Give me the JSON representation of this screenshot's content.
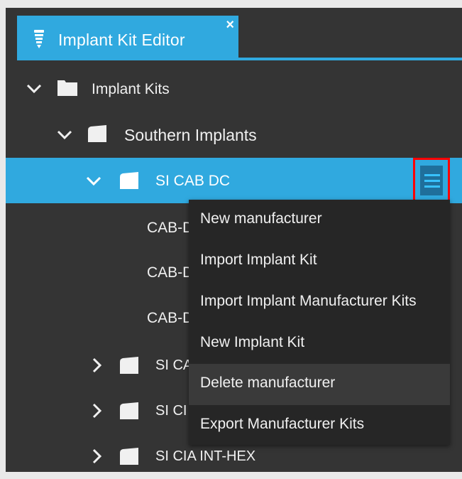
{
  "tab": {
    "title": "Implant Kit Editor",
    "close": "×",
    "icon": "implant-screw-icon",
    "overflow": "⋮"
  },
  "tree": {
    "root": {
      "label": "Implant Kits",
      "expanded": true,
      "icon": "folder-icon"
    },
    "manufacturer": {
      "label": "Southern Implants",
      "expanded": true,
      "icon": "folder-open-icon"
    },
    "selected_kit": {
      "label": "SI CAB DC",
      "expanded": true,
      "icon": "folder-open-icon"
    },
    "children": [
      {
        "label": "CAB-D"
      },
      {
        "label": "CAB-D"
      },
      {
        "label": "CAB-D"
      }
    ],
    "sibling_kits": [
      {
        "label": "SI CA",
        "expanded": false
      },
      {
        "label": "SI CI",
        "expanded": false
      },
      {
        "label": "SI CIA INT-HEX",
        "expanded": false
      }
    ]
  },
  "menu_button": {
    "icon": "hamburger-menu-icon",
    "highlight_color": "#ff0000"
  },
  "context_menu": {
    "items": [
      "New manufacturer",
      "Import Implant Kit",
      "Import Implant Manufacturer Kits",
      "New Implant Kit",
      "Delete manufacturer",
      "Export Manufacturer Kits"
    ],
    "hovered_item": "Delete manufacturer"
  },
  "colors": {
    "accent": "#30a9df",
    "panel": "#343434",
    "menu": "#262626",
    "highlight": "#ff0000"
  }
}
